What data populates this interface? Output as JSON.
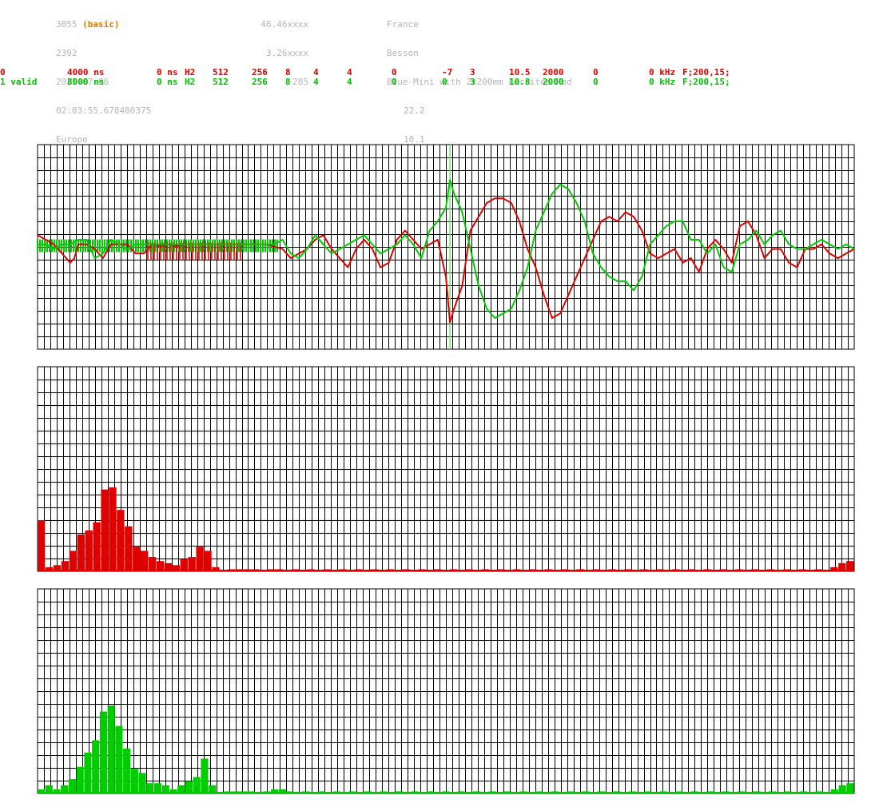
{
  "header": {
    "col1": {
      "station_id": "3055",
      "mode": "(basic)",
      "l2": "2392",
      "date": "2025-07-06",
      "time": "02:03:55.678400375",
      "region": "Europe"
    },
    "col2": {
      "lat": "46.46xxxx",
      "lon": "3.26xxxx",
      "alt": "285"
    },
    "col3": {
      "country": "France",
      "city": "Besson",
      "antenna": "Blue-Mini with 2x200mm Ferrites Rod",
      "v1": "22.2",
      "v2": "10.1"
    }
  },
  "channels": [
    {
      "name": "0",
      "v1": "4000 ns",
      "v2": "0 ns",
      "h": "H2",
      "a": "512",
      "b": "256",
      "c": "8",
      "d": "4",
      "e": "4",
      "f": "0",
      "g": "-7",
      "h2": "3",
      "i": "10.5",
      "j": "2000",
      "k": "0",
      "l": "0 kHz",
      "m": "F;200,15;"
    },
    {
      "name": "1 valid",
      "v1": "8000 ns",
      "v2": "0 ns",
      "h": "H2",
      "a": "512",
      "b": "256",
      "c": "8",
      "d": "4",
      "e": "4",
      "f": "0",
      "g": "0",
      "h2": "3",
      "i": "10.8",
      "j": "2000",
      "k": "0",
      "l": "0 kHz",
      "m": "F;200,15;"
    }
  ],
  "colors": {
    "red": "#e00000",
    "green": "#00cc00",
    "grid": "#000000",
    "marker": "#66ee66",
    "header": "#b4b4b4",
    "basic": "#e07a00"
  },
  "chart_data": [
    {
      "type": "line",
      "title": "",
      "grid": true,
      "marker_x": 0.505,
      "series": [
        {
          "name": "0",
          "color": "#e00000",
          "points": [
            [
              0.0,
              0.15
            ],
            [
              0.01,
              0.1
            ],
            [
              0.02,
              0.05
            ],
            [
              0.03,
              -0.05
            ],
            [
              0.04,
              -0.15
            ],
            [
              0.045,
              -0.1
            ],
            [
              0.05,
              0.05
            ],
            [
              0.06,
              0.05
            ],
            [
              0.07,
              0.0
            ],
            [
              0.08,
              -0.1
            ],
            [
              0.09,
              0.05
            ],
            [
              0.1,
              0.05
            ],
            [
              0.11,
              0.05
            ],
            [
              0.12,
              -0.05
            ],
            [
              0.13,
              -0.05
            ],
            [
              0.14,
              0.05
            ],
            [
              0.15,
              0.03
            ],
            [
              0.16,
              0.05
            ],
            [
              0.17,
              0.03
            ],
            [
              0.18,
              0.05
            ],
            [
              0.19,
              0.05
            ],
            [
              0.2,
              0.05
            ],
            [
              0.21,
              0.05
            ],
            [
              0.22,
              0.05
            ],
            [
              0.23,
              0.05
            ],
            [
              0.24,
              0.05
            ],
            [
              0.25,
              0.05
            ],
            [
              0.26,
              0.05
            ],
            [
              0.27,
              0.05
            ],
            [
              0.28,
              0.05
            ],
            [
              0.3,
              0.0
            ],
            [
              0.31,
              -0.1
            ],
            [
              0.32,
              -0.05
            ],
            [
              0.33,
              0.0
            ],
            [
              0.34,
              0.1
            ],
            [
              0.35,
              0.15
            ],
            [
              0.36,
              0.0
            ],
            [
              0.37,
              -0.1
            ],
            [
              0.38,
              -0.2
            ],
            [
              0.39,
              0.0
            ],
            [
              0.4,
              0.1
            ],
            [
              0.41,
              0.0
            ],
            [
              0.42,
              -0.2
            ],
            [
              0.43,
              -0.15
            ],
            [
              0.44,
              0.1
            ],
            [
              0.45,
              0.2
            ],
            [
              0.46,
              0.1
            ],
            [
              0.47,
              0.0
            ],
            [
              0.48,
              0.05
            ],
            [
              0.49,
              0.1
            ],
            [
              0.5,
              -0.3
            ],
            [
              0.505,
              -0.8
            ],
            [
              0.51,
              -0.65
            ],
            [
              0.52,
              -0.4
            ],
            [
              0.53,
              0.2
            ],
            [
              0.54,
              0.35
            ],
            [
              0.55,
              0.5
            ],
            [
              0.56,
              0.55
            ],
            [
              0.57,
              0.55
            ],
            [
              0.58,
              0.5
            ],
            [
              0.59,
              0.3
            ],
            [
              0.6,
              0.0
            ],
            [
              0.61,
              -0.2
            ],
            [
              0.62,
              -0.5
            ],
            [
              0.63,
              -0.75
            ],
            [
              0.64,
              -0.7
            ],
            [
              0.65,
              -0.5
            ],
            [
              0.66,
              -0.3
            ],
            [
              0.67,
              -0.1
            ],
            [
              0.68,
              0.1
            ],
            [
              0.69,
              0.3
            ],
            [
              0.7,
              0.35
            ],
            [
              0.71,
              0.3
            ],
            [
              0.72,
              0.4
            ],
            [
              0.73,
              0.35
            ],
            [
              0.74,
              0.2
            ],
            [
              0.75,
              -0.05
            ],
            [
              0.76,
              -0.1
            ],
            [
              0.77,
              -0.05
            ],
            [
              0.78,
              0.0
            ],
            [
              0.79,
              -0.15
            ],
            [
              0.8,
              -0.1
            ],
            [
              0.81,
              -0.25
            ],
            [
              0.82,
              0.0
            ],
            [
              0.83,
              0.1
            ],
            [
              0.84,
              0.0
            ],
            [
              0.85,
              -0.15
            ],
            [
              0.86,
              0.25
            ],
            [
              0.87,
              0.3
            ],
            [
              0.88,
              0.15
            ],
            [
              0.89,
              -0.1
            ],
            [
              0.9,
              0.0
            ],
            [
              0.91,
              0.0
            ],
            [
              0.92,
              -0.15
            ],
            [
              0.93,
              -0.2
            ],
            [
              0.94,
              0.0
            ],
            [
              0.95,
              0.0
            ],
            [
              0.96,
              0.05
            ],
            [
              0.97,
              -0.05
            ],
            [
              0.98,
              -0.1
            ],
            [
              0.99,
              -0.05
            ],
            [
              1.0,
              0.0
            ]
          ]
        },
        {
          "name": "1 valid",
          "color": "#00cc00",
          "points": [
            [
              0.0,
              0.05
            ],
            [
              0.01,
              0.05
            ],
            [
              0.02,
              0.0
            ],
            [
              0.03,
              0.05
            ],
            [
              0.04,
              0.05
            ],
            [
              0.05,
              0.1
            ],
            [
              0.06,
              0.1
            ],
            [
              0.07,
              -0.1
            ],
            [
              0.08,
              -0.05
            ],
            [
              0.09,
              0.1
            ],
            [
              0.1,
              0.05
            ],
            [
              0.11,
              0.0
            ],
            [
              0.12,
              0.05
            ],
            [
              0.13,
              0.05
            ],
            [
              0.14,
              0.05
            ],
            [
              0.15,
              0.05
            ],
            [
              0.16,
              0.05
            ],
            [
              0.17,
              0.05
            ],
            [
              0.18,
              0.05
            ],
            [
              0.19,
              0.05
            ],
            [
              0.2,
              0.05
            ],
            [
              0.21,
              0.05
            ],
            [
              0.22,
              0.05
            ],
            [
              0.23,
              0.05
            ],
            [
              0.24,
              0.05
            ],
            [
              0.25,
              0.05
            ],
            [
              0.26,
              0.05
            ],
            [
              0.27,
              0.05
            ],
            [
              0.28,
              0.05
            ],
            [
              0.29,
              0.05
            ],
            [
              0.3,
              0.1
            ],
            [
              0.31,
              -0.05
            ],
            [
              0.32,
              -0.1
            ],
            [
              0.33,
              0.0
            ],
            [
              0.34,
              0.15
            ],
            [
              0.35,
              0.05
            ],
            [
              0.36,
              -0.05
            ],
            [
              0.37,
              0.0
            ],
            [
              0.38,
              0.05
            ],
            [
              0.39,
              0.1
            ],
            [
              0.4,
              0.15
            ],
            [
              0.41,
              0.05
            ],
            [
              0.42,
              -0.05
            ],
            [
              0.43,
              0.0
            ],
            [
              0.44,
              0.05
            ],
            [
              0.45,
              0.15
            ],
            [
              0.46,
              0.05
            ],
            [
              0.47,
              -0.1
            ],
            [
              0.48,
              0.2
            ],
            [
              0.49,
              0.3
            ],
            [
              0.5,
              0.45
            ],
            [
              0.505,
              0.75
            ],
            [
              0.51,
              0.6
            ],
            [
              0.52,
              0.4
            ],
            [
              0.53,
              0.0
            ],
            [
              0.54,
              -0.4
            ],
            [
              0.55,
              -0.65
            ],
            [
              0.56,
              -0.75
            ],
            [
              0.57,
              -0.7
            ],
            [
              0.58,
              -0.65
            ],
            [
              0.59,
              -0.45
            ],
            [
              0.6,
              -0.2
            ],
            [
              0.61,
              0.2
            ],
            [
              0.62,
              0.4
            ],
            [
              0.63,
              0.6
            ],
            [
              0.64,
              0.7
            ],
            [
              0.65,
              0.65
            ],
            [
              0.66,
              0.5
            ],
            [
              0.67,
              0.3
            ],
            [
              0.68,
              -0.05
            ],
            [
              0.69,
              -0.2
            ],
            [
              0.7,
              -0.3
            ],
            [
              0.71,
              -0.35
            ],
            [
              0.72,
              -0.35
            ],
            [
              0.73,
              -0.45
            ],
            [
              0.74,
              -0.3
            ],
            [
              0.75,
              0.05
            ],
            [
              0.76,
              0.15
            ],
            [
              0.77,
              0.25
            ],
            [
              0.78,
              0.3
            ],
            [
              0.79,
              0.3
            ],
            [
              0.8,
              0.1
            ],
            [
              0.81,
              0.1
            ],
            [
              0.82,
              -0.05
            ],
            [
              0.83,
              0.05
            ],
            [
              0.84,
              -0.2
            ],
            [
              0.85,
              -0.25
            ],
            [
              0.86,
              0.05
            ],
            [
              0.87,
              0.1
            ],
            [
              0.88,
              0.2
            ],
            [
              0.89,
              0.05
            ],
            [
              0.9,
              0.15
            ],
            [
              0.91,
              0.2
            ],
            [
              0.92,
              0.05
            ],
            [
              0.93,
              0.0
            ],
            [
              0.94,
              0.0
            ],
            [
              0.95,
              0.05
            ],
            [
              0.96,
              0.1
            ],
            [
              0.97,
              0.05
            ],
            [
              0.98,
              0.0
            ],
            [
              0.99,
              0.05
            ],
            [
              1.0,
              0.0
            ]
          ]
        }
      ]
    },
    {
      "type": "bar",
      "title": "",
      "grid": true,
      "color": "#e00000",
      "ylim": [
        0,
        1
      ],
      "values": [
        0.25,
        0.02,
        0.03,
        0.05,
        0.1,
        0.18,
        0.2,
        0.24,
        0.4,
        0.41,
        0.3,
        0.22,
        0.12,
        0.1,
        0.07,
        0.05,
        0.04,
        0.03,
        0.06,
        0.07,
        0.12,
        0.1,
        0.02,
        0.0,
        0.01,
        0.01,
        0.01,
        0.01,
        0.0,
        0.01,
        0.01,
        0.0,
        0.01,
        0.0,
        0.01,
        0.0,
        0.01,
        0.0,
        0.01,
        0.0,
        0.01,
        0.0,
        0.01,
        0.0,
        0.01,
        0.0,
        0.01,
        0.0,
        0.01,
        0.0,
        0.01,
        0.0,
        0.01,
        0.0,
        0.01,
        0.0,
        0.01,
        0.0,
        0.01,
        0.0,
        0.01,
        0.0,
        0.01,
        0.0,
        0.01,
        0.0,
        0.01,
        0.0,
        0.01,
        0.0,
        0.01,
        0.0,
        0.01,
        0.0,
        0.01,
        0.0,
        0.01,
        0.0,
        0.01,
        0.0,
        0.01,
        0.0,
        0.01,
        0.0,
        0.01,
        0.0,
        0.01,
        0.0,
        0.01,
        0.0,
        0.01,
        0.0,
        0.01,
        0.0,
        0.01,
        0.0,
        0.01,
        0.0,
        0.01,
        0.0,
        0.02,
        0.04,
        0.05
      ]
    },
    {
      "type": "bar",
      "title": "",
      "grid": true,
      "color": "#00cc00",
      "ylim": [
        0,
        1
      ],
      "values": [
        0.02,
        0.04,
        0.02,
        0.04,
        0.07,
        0.13,
        0.2,
        0.26,
        0.4,
        0.43,
        0.33,
        0.22,
        0.12,
        0.1,
        0.05,
        0.05,
        0.04,
        0.02,
        0.04,
        0.06,
        0.08,
        0.17,
        0.04,
        0.0,
        0.01,
        0.01,
        0.01,
        0.01,
        0.0,
        0.01,
        0.02,
        0.02,
        0.01,
        0.0,
        0.01,
        0.0,
        0.01,
        0.0,
        0.01,
        0.0,
        0.01,
        0.0,
        0.01,
        0.0,
        0.01,
        0.0,
        0.01,
        0.0,
        0.01,
        0.0,
        0.01,
        0.0,
        0.01,
        0.0,
        0.01,
        0.0,
        0.01,
        0.0,
        0.01,
        0.0,
        0.01,
        0.0,
        0.01,
        0.0,
        0.01,
        0.0,
        0.01,
        0.0,
        0.01,
        0.0,
        0.01,
        0.0,
        0.01,
        0.0,
        0.01,
        0.0,
        0.01,
        0.0,
        0.01,
        0.0,
        0.01,
        0.0,
        0.01,
        0.0,
        0.01,
        0.0,
        0.01,
        0.0,
        0.01,
        0.0,
        0.01,
        0.0,
        0.01,
        0.0,
        0.01,
        0.0,
        0.01,
        0.0,
        0.01,
        0.0,
        0.01,
        0.0,
        0.02,
        0.04,
        0.05
      ]
    }
  ]
}
